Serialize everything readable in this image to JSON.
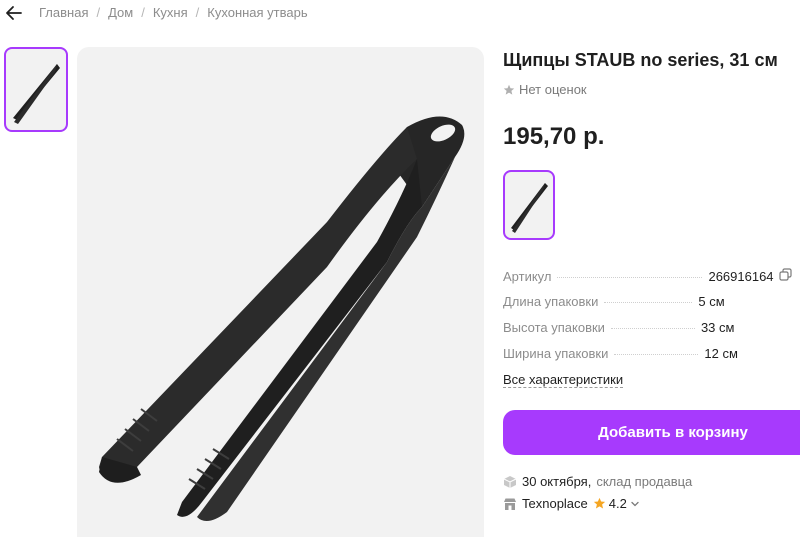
{
  "breadcrumb": [
    "Главная",
    "Дом",
    "Кухня",
    "Кухонная утварь"
  ],
  "product": {
    "title": "Щипцы STAUB no series, 31 см",
    "rating_text": "Нет оценок",
    "price": "195,70 р."
  },
  "specs": [
    {
      "label": "Артикул",
      "value": "266916164"
    },
    {
      "label": "Длина упаковки",
      "value": "5 см"
    },
    {
      "label": "Высота упаковки",
      "value": "33 см"
    },
    {
      "label": "Ширина упаковки",
      "value": "12 см"
    }
  ],
  "all_specs_link": "Все характеристики",
  "cart_button": "Добавить в корзину",
  "delivery": {
    "date": "30 октября,",
    "source": "склад продавца"
  },
  "seller": {
    "name": "Texnoplace",
    "rating": "4.2"
  },
  "icons": {
    "back": "arrow-left-icon",
    "star": "star-icon",
    "copy": "copy-icon",
    "box": "box-icon",
    "shop": "shop-icon",
    "chevron": "chevron-down-icon"
  },
  "colors": {
    "accent": "#a73afd",
    "star_orange": "#f5a623",
    "image_bg": "#f2f2f2"
  }
}
